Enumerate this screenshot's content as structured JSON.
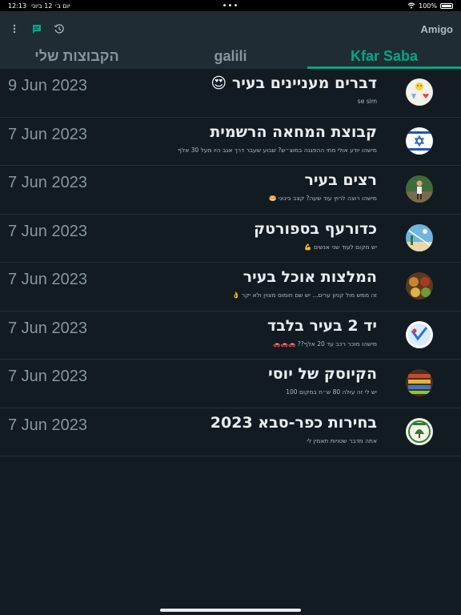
{
  "status_bar": {
    "time": "12:13",
    "day": "יום ב׳ 12 ביוני",
    "battery": "100%",
    "dots": "•••"
  },
  "header": {
    "title": "Amigo"
  },
  "tabs": [
    {
      "label": "הקבוצות שלי",
      "active": false
    },
    {
      "label": "galili",
      "active": false
    },
    {
      "label": "Kfar Saba",
      "active": true
    }
  ],
  "rows": [
    {
      "title": "דברים מעניינים בעיר 😍",
      "subtitle": "se sim",
      "date": "9 Jun 2023",
      "avatar": "stickers"
    },
    {
      "title": "קבוצת המחאה הרשמית",
      "subtitle": "מישהו יודע אולי מתי ההפגנה במוצ״ש? שבוע שעבר דרך אגב היו מעל 30 אלף",
      "date": "7 Jun 2023",
      "avatar": "flag"
    },
    {
      "title": "רצים בעיר",
      "subtitle": "מישהו רוצה לרוץ עוד שעה? קצב בינוני 🥯",
      "date": "7 Jun 2023",
      "avatar": "runner"
    },
    {
      "title": "כדורעף בספורטק",
      "subtitle": "יש מקום לעוד שני אנשים 💪",
      "date": "7 Jun 2023",
      "avatar": "volleyball"
    },
    {
      "title": "המלצות אוכל בעיר",
      "subtitle": "זה ממש מול קניון ערים... יש שם חומוס מצוין ולא יקר 👌",
      "date": "7 Jun 2023",
      "avatar": "food"
    },
    {
      "title": "יד 2 בעיר בלבד",
      "subtitle": "מישהו מוכר רכב עד 20 אלף?? 🚗🚗🚗",
      "date": "7 Jun 2023",
      "avatar": "yad2"
    },
    {
      "title": "הקיוסק של יוסי",
      "subtitle": "יש לי זה עולה 80 ש״ח במקום 100",
      "date": "7 Jun 2023",
      "avatar": "kiosk"
    },
    {
      "title": "בחירות כפר-סבא 2023",
      "subtitle": "אתה מדבר שטויות תאמין לי",
      "date": "7 Jun 2023",
      "avatar": "emblem"
    }
  ],
  "colors": {
    "accent": "#00a884",
    "background": "#111b21",
    "header": "#1f2c34"
  }
}
